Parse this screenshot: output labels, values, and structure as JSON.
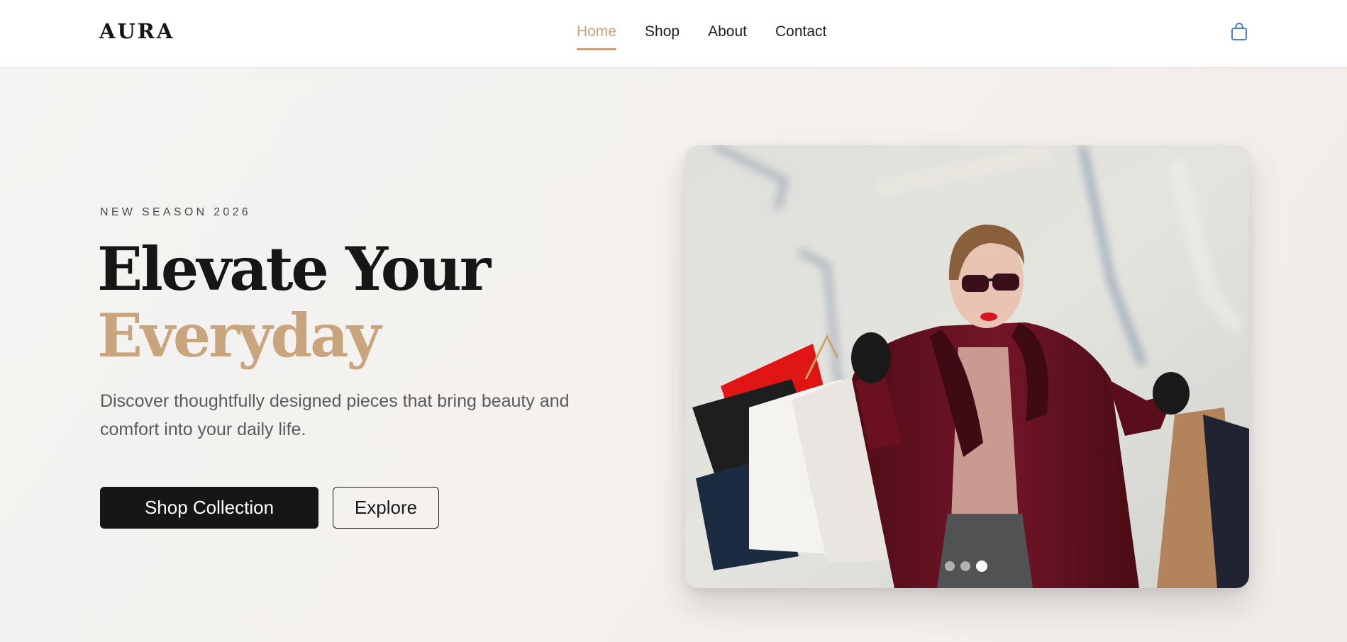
{
  "brand": {
    "logo": "AURA"
  },
  "nav": {
    "items": [
      {
        "label": "Home",
        "active": true
      },
      {
        "label": "Shop",
        "active": false
      },
      {
        "label": "About",
        "active": false
      },
      {
        "label": "Contact",
        "active": false
      }
    ],
    "cart_icon": "shopping-bag-icon"
  },
  "hero": {
    "eyebrow": "NEW SEASON 2026",
    "headline_line1": "Elevate Your",
    "headline_line2": "Everyday",
    "subtitle": "Discover thoughtfully designed pieces that bring beauty and comfort into your daily life.",
    "primary_button": "Shop Collection",
    "secondary_button": "Explore",
    "carousel": {
      "slide_count": 3,
      "active_slide": 3
    }
  },
  "colors": {
    "accent": "#c9a57e",
    "text_dark": "#161616",
    "text_muted": "#5a5a5a",
    "cart_icon": "#4a7fd0",
    "coat": "#6b1322"
  }
}
